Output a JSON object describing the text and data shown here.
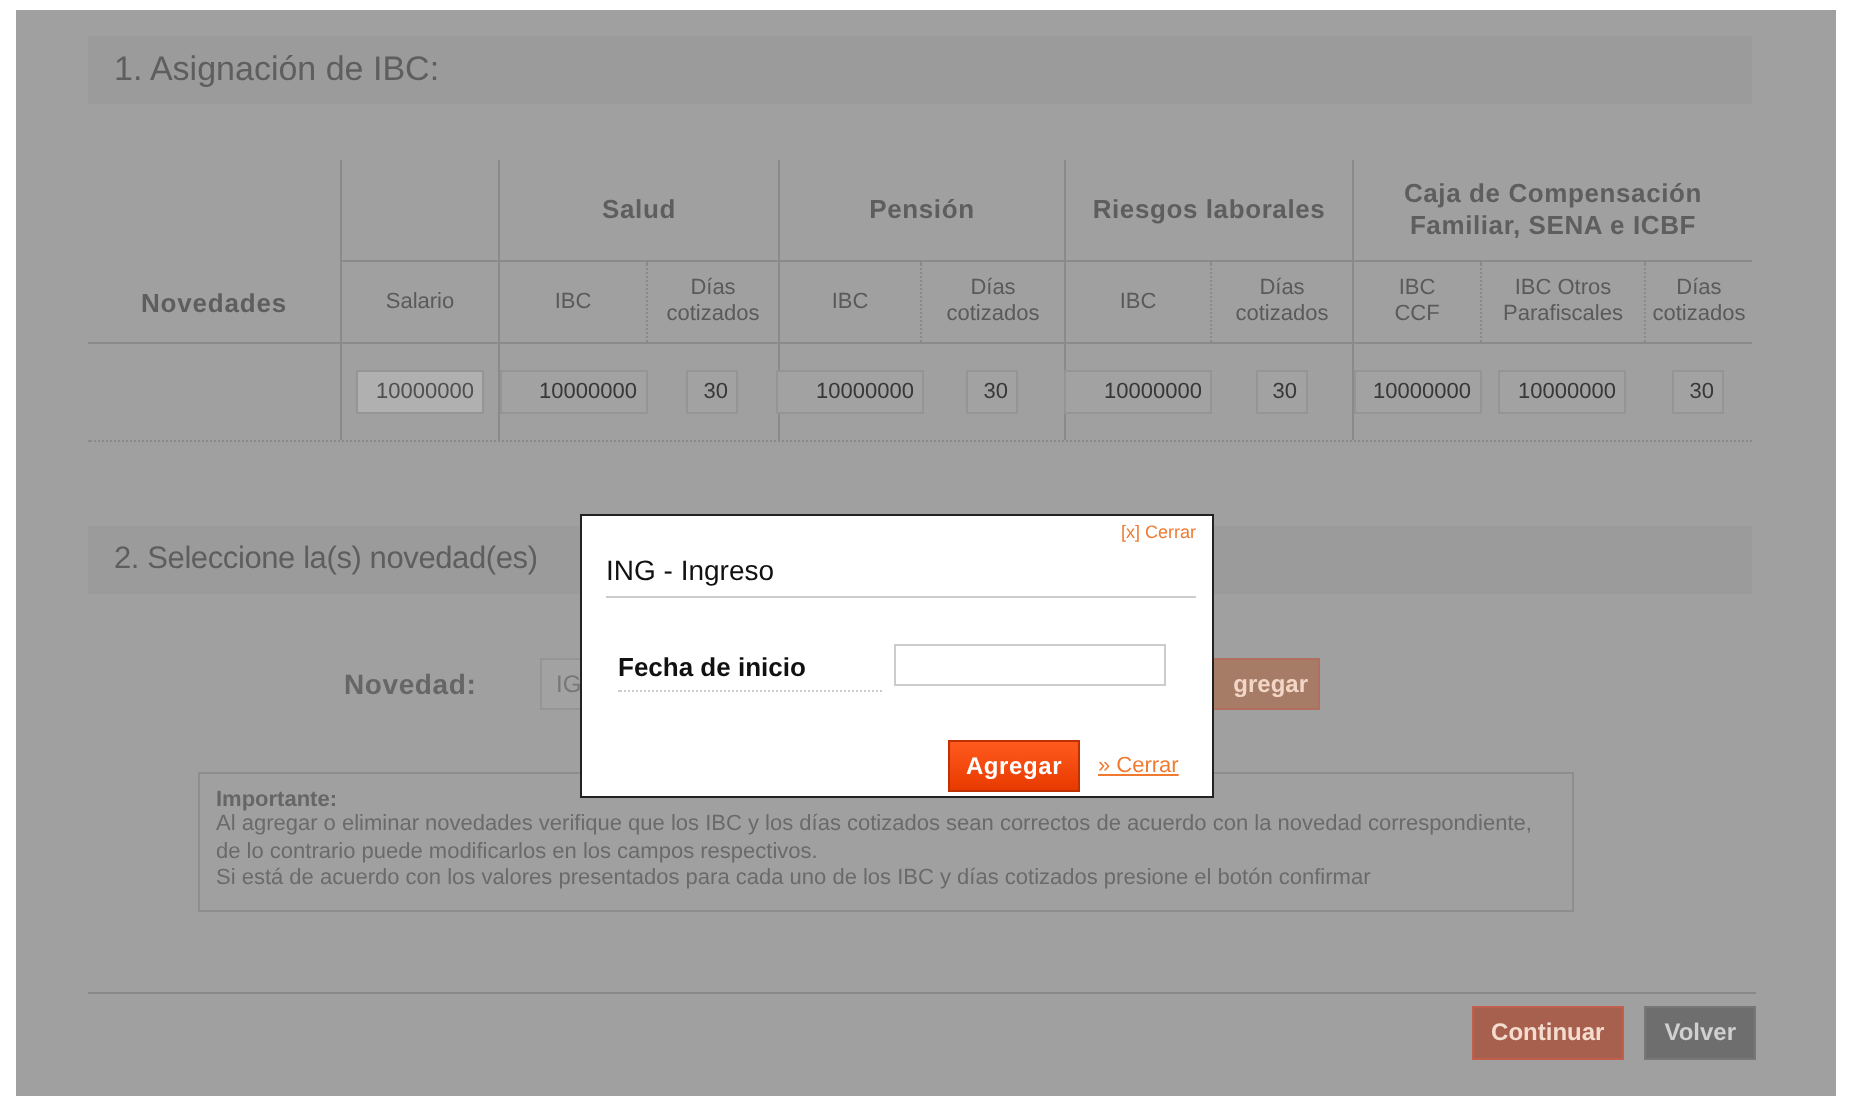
{
  "section_1": {
    "title": "1. Asignación de IBC:"
  },
  "table": {
    "row_header": "Novedades",
    "lead_column": {
      "label": "Salario",
      "value": "10000000",
      "disabled": true
    },
    "groups": [
      {
        "label": "Salud",
        "columns": [
          {
            "label": "IBC",
            "value": "10000000",
            "disabled": false
          },
          {
            "label": "Días cotizados",
            "value": "30",
            "disabled": false
          }
        ]
      },
      {
        "label": "Pensión",
        "columns": [
          {
            "label": "IBC",
            "value": "10000000",
            "disabled": false
          },
          {
            "label": "Días cotizados",
            "value": "30",
            "disabled": false
          }
        ]
      },
      {
        "label": "Riesgos laborales",
        "columns": [
          {
            "label": "IBC",
            "value": "10000000",
            "disabled": false
          },
          {
            "label": "Días cotizados",
            "value": "30",
            "disabled": false
          }
        ]
      },
      {
        "label": "Caja de Compensación\nFamiliar, SENA e ICBF",
        "columns": [
          {
            "label": "IBC\nCCF",
            "value": "10000000",
            "disabled": false
          },
          {
            "label": "IBC Otros\nParafiscales",
            "value": "10000000",
            "disabled": false
          },
          {
            "label": "Días\ncotizados",
            "value": "30",
            "disabled": false
          }
        ]
      }
    ]
  },
  "section_2": {
    "title": "2. Seleccione la(s) novedad(es)",
    "novedad_label": "Novedad:",
    "novedad_value": "IG",
    "add_button": "gregar"
  },
  "notice": {
    "title": "Importante:",
    "lines": [
      "Al agregar o eliminar novedades verifique que los IBC y los días cotizados sean correctos de acuerdo con la novedad correspondiente,",
      "de lo contrario puede modificarlos en los campos respectivos.",
      "Si está de acuerdo con los valores presentados para cada uno de los IBC y días cotizados presione el botón confirmar"
    ]
  },
  "footer_buttons": [
    {
      "label": "Continuar",
      "kind": "primary"
    },
    {
      "label": "Volver",
      "kind": "secondary"
    }
  ],
  "modal": {
    "close_link": "[x] Cerrar",
    "title": "ING - Ingreso",
    "field_label": "Fecha de inicio",
    "submit": "Agregar",
    "cancel_link": "» Cerrar"
  }
}
